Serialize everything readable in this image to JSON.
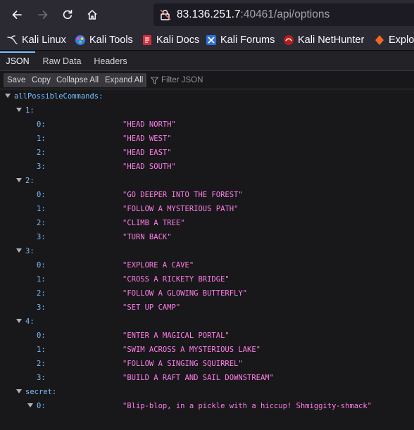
{
  "browser": {
    "url_host": "83.136.251.7",
    "url_rest": ":40461/api/options"
  },
  "bookmarks": [
    {
      "label": "Kali Linux",
      "icon": "kali-dragon-icon"
    },
    {
      "label": "Kali Tools",
      "icon": "kali-tools-icon"
    },
    {
      "label": "Kali Docs",
      "icon": "kali-docs-icon"
    },
    {
      "label": "Kali Forums",
      "icon": "kali-forums-icon"
    },
    {
      "label": "Kali NetHunter",
      "icon": "kali-nethunter-icon"
    },
    {
      "label": "Exploit-DB",
      "icon": "exploit-db-icon"
    }
  ],
  "viewer": {
    "tabs": [
      "JSON",
      "Raw Data",
      "Headers"
    ],
    "toolbar": {
      "save": "Save",
      "copy": "Copy",
      "collapse_all": "Collapse All",
      "expand_all": "Expand All",
      "filter_placeholder": "Filter JSON"
    }
  },
  "json": {
    "root_key": "allPossibleCommands:",
    "groups": [
      {
        "key": "1:",
        "items": [
          {
            "k": "0:",
            "v": "\"HEAD NORTH\""
          },
          {
            "k": "1:",
            "v": "\"HEAD WEST\""
          },
          {
            "k": "2:",
            "v": "\"HEAD EAST\""
          },
          {
            "k": "3:",
            "v": "\"HEAD SOUTH\""
          }
        ]
      },
      {
        "key": "2:",
        "items": [
          {
            "k": "0:",
            "v": "\"GO DEEPER INTO THE FOREST\""
          },
          {
            "k": "1:",
            "v": "\"FOLLOW A MYSTERIOUS PATH\""
          },
          {
            "k": "2:",
            "v": "\"CLIMB A TREE\""
          },
          {
            "k": "3:",
            "v": "\"TURN BACK\""
          }
        ]
      },
      {
        "key": "3:",
        "items": [
          {
            "k": "0:",
            "v": "\"EXPLORE A CAVE\""
          },
          {
            "k": "1:",
            "v": "\"CROSS A RICKETY BRIDGE\""
          },
          {
            "k": "2:",
            "v": "\"FOLLOW A GLOWING BUTTERFLY\""
          },
          {
            "k": "3:",
            "v": "\"SET UP CAMP\""
          }
        ]
      },
      {
        "key": "4:",
        "items": [
          {
            "k": "0:",
            "v": "\"ENTER A MAGICAL PORTAL\""
          },
          {
            "k": "1:",
            "v": "\"SWIM ACROSS A MYSTERIOUS LAKE\""
          },
          {
            "k": "2:",
            "v": "\"FOLLOW A SINGING SQUIRREL\""
          },
          {
            "k": "3:",
            "v": "\"BUILD A RAFT AND SAIL DOWNSTREAM\""
          }
        ]
      },
      {
        "key": "secret:",
        "items": [
          {
            "k": "0:",
            "v": "\"Blip-blop, in a pickle with a hiccup! Shmiggity-shmack\""
          }
        ]
      }
    ]
  },
  "colors": {
    "key": "#75bfff",
    "string": "#ff7de9",
    "accent": "#75bfff"
  }
}
